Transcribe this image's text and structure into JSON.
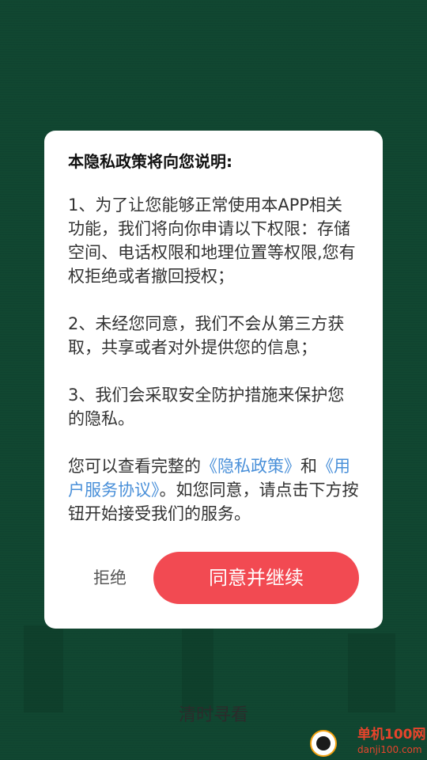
{
  "dialog": {
    "title": "本隐私政策将向您说明:",
    "items": [
      "1、为了让您能够正常使用本APP相关功能，我们将向你申请以下权限：存储空间、电话权限和地理位置等权限,您有权拒绝或者撤回授权；",
      "2、未经您同意，我们不会从第三方获取，共享或者对外提供您的信息；",
      "3、我们会采取安全防护措施来保护您的隐私。"
    ],
    "footer": {
      "prefix": "您可以查看完整的",
      "privacy_link": "《隐私政策》",
      "and": "和",
      "service_link": "《用户服务协议》",
      "suffix": "。如您同意，请点击下方按钮开始接受我们的服务。"
    },
    "reject_label": "拒绝",
    "agree_label": "同意并继续"
  },
  "bottom_label": "清时寻看",
  "watermark": {
    "name": "单机100网",
    "domain": "danji100.com"
  },
  "colors": {
    "background": "#134e36",
    "accent": "#f24a52",
    "link": "#4a90d9"
  }
}
